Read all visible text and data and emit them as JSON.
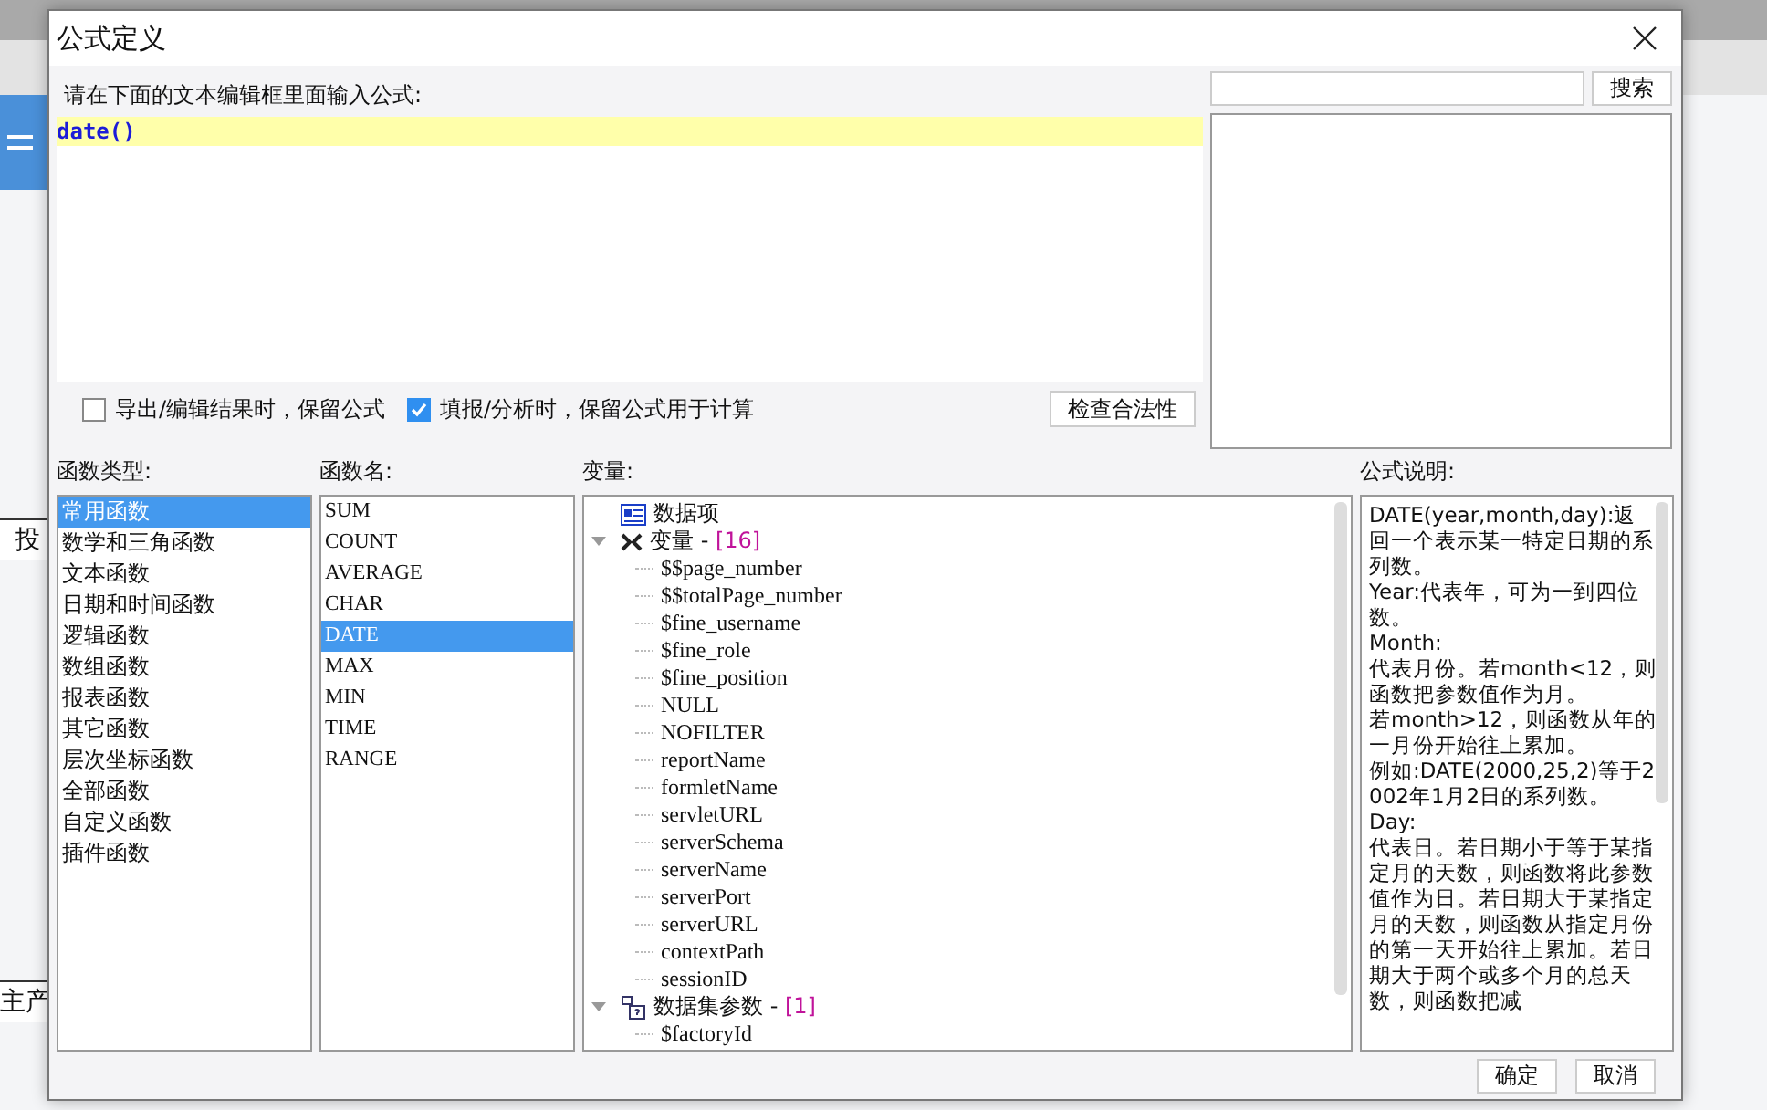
{
  "background": {
    "texts": [
      {
        "text": "投"
      },
      {
        "text": "主产"
      }
    ]
  },
  "dialog": {
    "title": "公式定义",
    "editor": {
      "label": "请在下面的文本编辑框里面输入公式:",
      "value": "date()"
    },
    "search": {
      "button": "搜索"
    },
    "options": [
      {
        "label": "导出/编辑结果时，保留公式",
        "checked": false
      },
      {
        "label": "填报/分析时，保留公式用于计算",
        "checked": true
      }
    ],
    "check_button": "检查合法性",
    "function_types": {
      "label": "函数类型:",
      "items": [
        {
          "label": "常用函数",
          "selected": true
        },
        {
          "label": "数学和三角函数",
          "selected": false
        },
        {
          "label": "文本函数",
          "selected": false
        },
        {
          "label": "日期和时间函数",
          "selected": false
        },
        {
          "label": "逻辑函数",
          "selected": false
        },
        {
          "label": "数组函数",
          "selected": false
        },
        {
          "label": "报表函数",
          "selected": false
        },
        {
          "label": "其它函数",
          "selected": false
        },
        {
          "label": "层次坐标函数",
          "selected": false
        },
        {
          "label": "全部函数",
          "selected": false
        },
        {
          "label": "自定义函数",
          "selected": false
        },
        {
          "label": "插件函数",
          "selected": false
        }
      ]
    },
    "function_names": {
      "label": "函数名:",
      "items": [
        {
          "label": "SUM",
          "selected": false
        },
        {
          "label": "COUNT",
          "selected": false
        },
        {
          "label": "AVERAGE",
          "selected": false
        },
        {
          "label": "CHAR",
          "selected": false
        },
        {
          "label": "DATE",
          "selected": true
        },
        {
          "label": "MAX",
          "selected": false
        },
        {
          "label": "MIN",
          "selected": false
        },
        {
          "label": "TIME",
          "selected": false
        },
        {
          "label": "RANGE",
          "selected": false
        }
      ]
    },
    "variables": {
      "label": "变量:",
      "tree": [
        {
          "kind": "data",
          "label": "数据项"
        },
        {
          "kind": "variables",
          "label": "变量 - ",
          "count": "[16]",
          "expanded": true,
          "children": [
            {
              "label": "$$page_number"
            },
            {
              "label": "$$totalPage_number"
            },
            {
              "label": "$fine_username"
            },
            {
              "label": "$fine_role"
            },
            {
              "label": "$fine_position"
            },
            {
              "label": "NULL"
            },
            {
              "label": "NOFILTER"
            },
            {
              "label": "reportName"
            },
            {
              "label": "formletName"
            },
            {
              "label": "servletURL"
            },
            {
              "label": "serverSchema"
            },
            {
              "label": "serverName"
            },
            {
              "label": "serverPort"
            },
            {
              "label": "serverURL"
            },
            {
              "label": "contextPath"
            },
            {
              "label": "sessionID"
            }
          ]
        },
        {
          "kind": "parameters",
          "label": "数据集参数 - ",
          "count": "[1]",
          "expanded": true,
          "children": [
            {
              "label": "$factoryId"
            }
          ]
        }
      ]
    },
    "description": {
      "label": "公式说明:",
      "paragraphs": [
        "DATE(year,month,day):返回一个表示某一特定日期的系列数。",
        "Year:代表年，可为一到四位数。",
        "Month:",
        "代表月份。若month<12，则函数把参数值作为月。",
        "若month>12，则函数从年的一月份开始往上累加。",
        "例如:DATE(2000,25,2)等于2002年1月2日的系列数。",
        "Day:",
        "代表日。若日期小于等于某指定月的天数，则函数将此参数值作为日。若日期大于某指定月的天数，则函数从指定月份的第一天开始往上累加。若日期大于两个或多个月的总天数，则函数把减"
      ]
    },
    "buttons": [
      "确定",
      "取消"
    ]
  }
}
